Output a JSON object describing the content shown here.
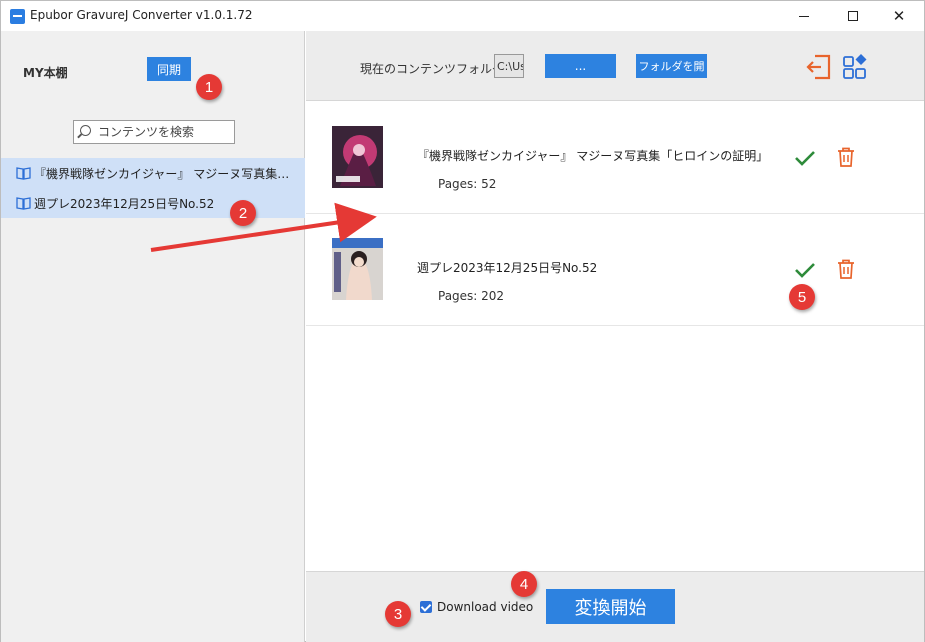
{
  "window": {
    "title": "Epubor GravureJ Converter v1.0.1.72",
    "close_glyph": "✕"
  },
  "sidebar": {
    "title": "MY本棚",
    "sync_label": "同期",
    "search_placeholder": "コンテンツを検索",
    "books": [
      {
        "label": "『機界戦隊ゼンカイジャー』 マジーヌ写真集「ヒロイン..."
      },
      {
        "label": "週プレ2023年12月25日号No.52"
      }
    ]
  },
  "toolbar": {
    "folder_label": "現在のコンテンツフォルダ：",
    "folder_path": "C:\\Us",
    "browse_label": "...",
    "open_folder_label": "フォルダを開",
    "export_icon": "export-icon",
    "layout_icon": "layout-grid-icon",
    "accent_color": "#e8642c"
  },
  "rows": [
    {
      "title": "『機界戦隊ゼンカイジャー』 マジーヌ写真集「ヒロインの証明」",
      "pages": "Pages: 52"
    },
    {
      "title": "週プレ2023年12月25日号No.52",
      "pages": "Pages: 202"
    }
  ],
  "bottom": {
    "download_video_label": "Download video",
    "download_video_checked": true,
    "convert_label": "変換開始"
  },
  "annotations": [
    "1",
    "2",
    "3",
    "4",
    "5"
  ],
  "colors": {
    "primary_button": "#2d82e0",
    "selected_row": "#cfe0f7",
    "check": "#2e8b3a",
    "trash": "#e8642c",
    "badge": "#e53935"
  }
}
